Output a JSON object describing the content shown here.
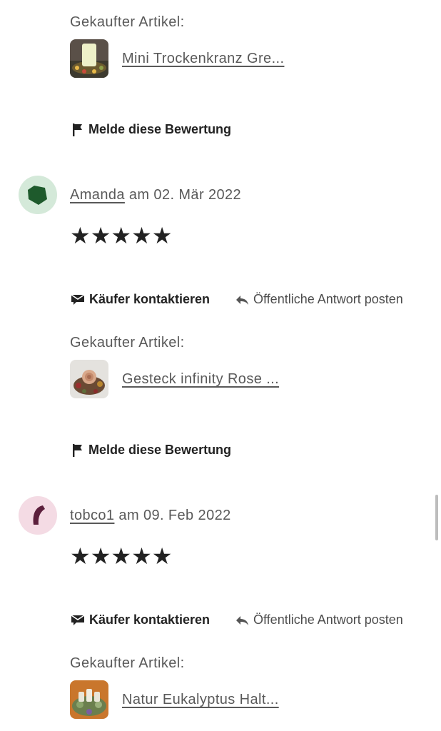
{
  "colors": {
    "avatar_green_bg": "#d4e9d9",
    "avatar_green_fg": "#1e5a2c",
    "avatar_pink_bg": "#f4dbe4",
    "avatar_pink_fg": "#5c1f3c",
    "text": "#222222",
    "muted": "#595959"
  },
  "review_top": {
    "purchased_label": "Gekaufter Artikel:",
    "item_title": "Mini Trockenkranz Gre...",
    "report": "Melde diese Bewertung"
  },
  "review_amanda": {
    "reviewer": "Amanda",
    "date_text": "am 02. Mär 2022",
    "stars": "★★★★★",
    "rating": 5,
    "contact": "Käufer kontaktieren",
    "reply": "Öffentliche Antwort posten",
    "purchased_label": "Gekaufter Artikel:",
    "item_title": "Gesteck infinity Rose ...",
    "report": "Melde diese Bewertung"
  },
  "review_tobco": {
    "reviewer": "tobco1",
    "date_text": "am 09. Feb 2022",
    "stars": "★★★★★",
    "rating": 5,
    "contact": "Käufer kontaktieren",
    "reply": "Öffentliche Antwort posten",
    "purchased_label": "Gekaufter Artikel:",
    "item_title": "Natur Eukalyptus Halt..."
  },
  "icons": [
    "flag-icon",
    "envelope-icon",
    "reply-arrow-icon",
    "star-icon"
  ]
}
